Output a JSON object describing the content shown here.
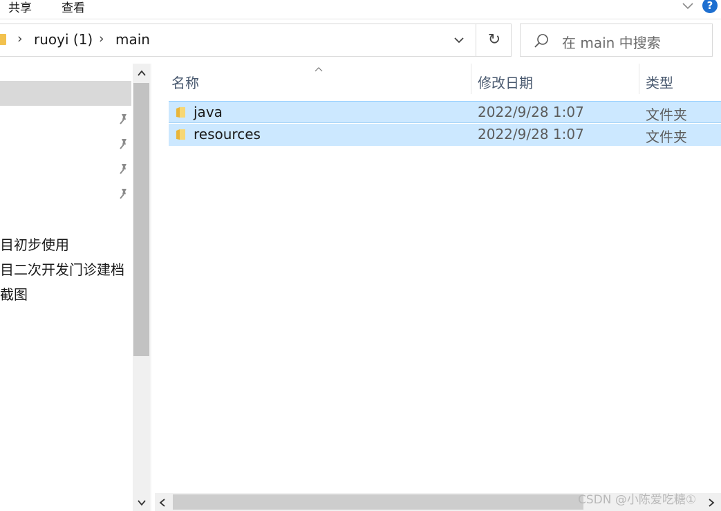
{
  "ribbon": {
    "tabs": [
      "共享",
      "查看"
    ],
    "help_symbol": "?"
  },
  "address_bar": {
    "breadcrumb": [
      "ruoyi (1)",
      "main"
    ],
    "separator": "›",
    "refresh_symbol": "↻"
  },
  "search": {
    "placeholder": "在 main 中搜索"
  },
  "nav_pane": {
    "pinned_count": 4,
    "items": [
      "目初步使用",
      "目二次开发门诊建档",
      "截图"
    ]
  },
  "columns": {
    "name": "名称",
    "date_modified": "修改日期",
    "type": "类型"
  },
  "files": [
    {
      "name": "java",
      "date_modified": "2022/9/28 1:07",
      "type": "文件夹"
    },
    {
      "name": "resources",
      "date_modified": "2022/9/28 1:07",
      "type": "文件夹"
    }
  ],
  "watermark": "CSDN @小陈爱吃糖①",
  "colors": {
    "selection": "#cce8ff",
    "folder": "#f2c14e",
    "help": "#1e6fd0"
  }
}
